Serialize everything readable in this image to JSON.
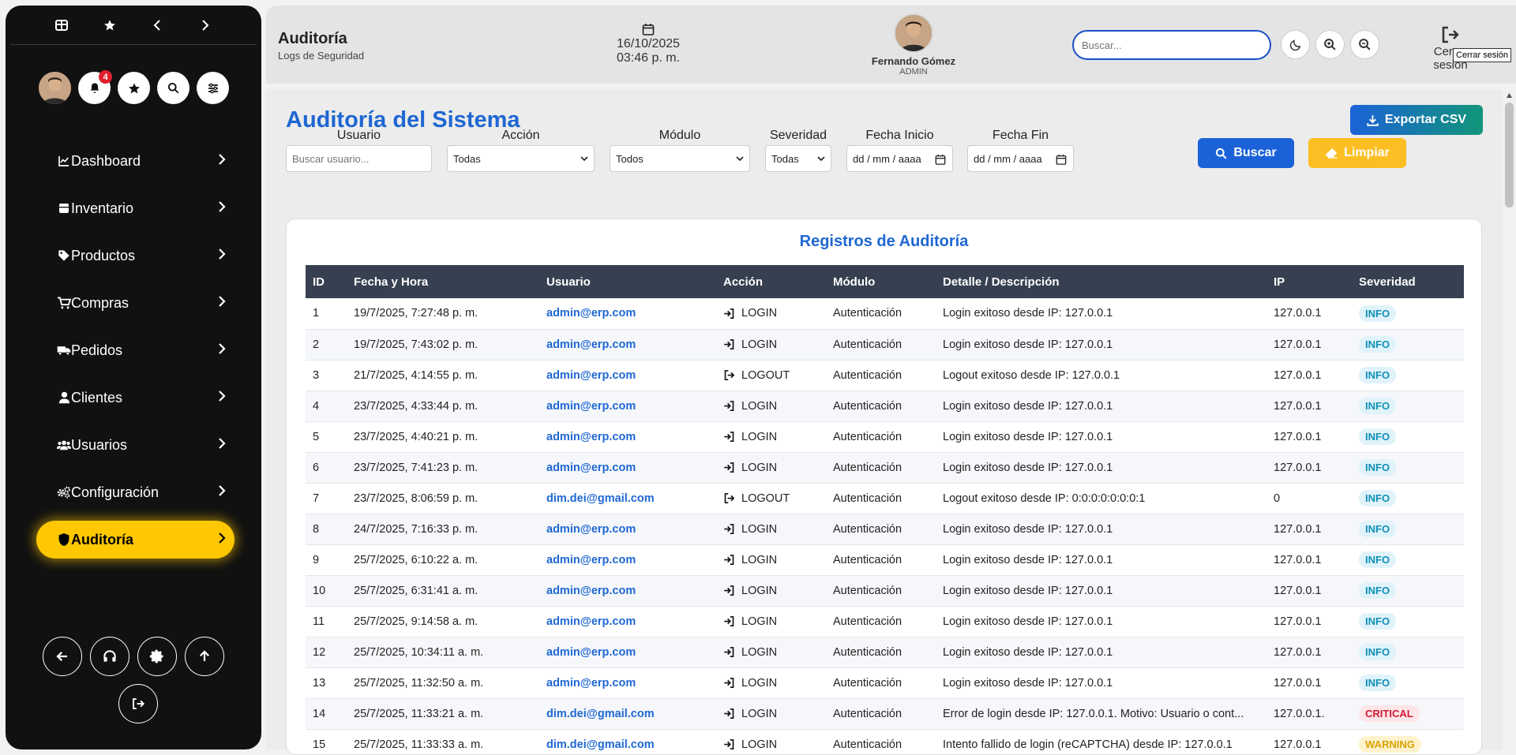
{
  "sidebar": {
    "notifications_count": "4",
    "nav": [
      {
        "label": "Dashboard",
        "icon": "chart-line-icon"
      },
      {
        "label": "Inventario",
        "icon": "box-icon"
      },
      {
        "label": "Productos",
        "icon": "tag-icon"
      },
      {
        "label": "Compras",
        "icon": "cart-icon"
      },
      {
        "label": "Pedidos",
        "icon": "truck-icon"
      },
      {
        "label": "Clientes",
        "icon": "user-icon"
      },
      {
        "label": "Usuarios",
        "icon": "users-icon"
      },
      {
        "label": "Configuración",
        "icon": "gears-icon"
      },
      {
        "label": "Auditoría",
        "icon": "shield-icon",
        "active": true
      }
    ]
  },
  "header": {
    "title": "Auditoría",
    "subtitle": "Logs de Seguridad",
    "date": "16/10/2025",
    "time": "03:46 p. m.",
    "user_name": "Fernando Gómez",
    "user_role": "ADMIN",
    "search_placeholder": "Buscar...",
    "logout_label": "Cerrar sesión",
    "logout_tooltip": "Cerrar sesión"
  },
  "main": {
    "title": "Auditoría del Sistema",
    "export_label": "Exportar CSV",
    "filters": {
      "usuario_label": "Usuario",
      "usuario_placeholder": "Buscar usuario...",
      "accion_label": "Acción",
      "accion_value": "Todas",
      "modulo_label": "Módulo",
      "modulo_value": "Todos",
      "severidad_label": "Severidad",
      "severidad_value": "Todas",
      "fecha_inicio_label": "Fecha Inicio",
      "fecha_inicio_value": "dd / mm / aaaa",
      "fecha_fin_label": "Fecha Fin",
      "fecha_fin_value": "dd / mm / aaaa",
      "buscar_label": "Buscar",
      "limpiar_label": "Limpiar"
    },
    "table_title": "Registros de Auditoría",
    "columns": [
      "ID",
      "Fecha y Hora",
      "Usuario",
      "Acción",
      "Módulo",
      "Detalle / Descripción",
      "IP",
      "Severidad"
    ],
    "rows": [
      {
        "id": "1",
        "fecha": "19/7/2025, 7:27:48 p. m.",
        "usuario": "admin@erp.com",
        "accion": "LOGIN",
        "modulo": "Autenticación",
        "detalle": "Login exitoso desde IP: 127.0.0.1",
        "ip": "127.0.0.1",
        "severidad": "INFO"
      },
      {
        "id": "2",
        "fecha": "19/7/2025, 7:43:02 p. m.",
        "usuario": "admin@erp.com",
        "accion": "LOGIN",
        "modulo": "Autenticación",
        "detalle": "Login exitoso desde IP: 127.0.0.1",
        "ip": "127.0.0.1",
        "severidad": "INFO"
      },
      {
        "id": "3",
        "fecha": "21/7/2025, 4:14:55 p. m.",
        "usuario": "admin@erp.com",
        "accion": "LOGOUT",
        "modulo": "Autenticación",
        "detalle": "Logout exitoso desde IP: 127.0.0.1",
        "ip": "127.0.0.1",
        "severidad": "INFO"
      },
      {
        "id": "4",
        "fecha": "23/7/2025, 4:33:44 p. m.",
        "usuario": "admin@erp.com",
        "accion": "LOGIN",
        "modulo": "Autenticación",
        "detalle": "Login exitoso desde IP: 127.0.0.1",
        "ip": "127.0.0.1",
        "severidad": "INFO"
      },
      {
        "id": "5",
        "fecha": "23/7/2025, 4:40:21 p. m.",
        "usuario": "admin@erp.com",
        "accion": "LOGIN",
        "modulo": "Autenticación",
        "detalle": "Login exitoso desde IP: 127.0.0.1",
        "ip": "127.0.0.1",
        "severidad": "INFO"
      },
      {
        "id": "6",
        "fecha": "23/7/2025, 7:41:23 p. m.",
        "usuario": "admin@erp.com",
        "accion": "LOGIN",
        "modulo": "Autenticación",
        "detalle": "Login exitoso desde IP: 127.0.0.1",
        "ip": "127.0.0.1",
        "severidad": "INFO"
      },
      {
        "id": "7",
        "fecha": "23/7/2025, 8:06:59 p. m.",
        "usuario": "dim.dei@gmail.com",
        "accion": "LOGOUT",
        "modulo": "Autenticación",
        "detalle": "Logout exitoso desde IP: 0:0:0:0:0:0:0:1",
        "ip": "0",
        "severidad": "INFO"
      },
      {
        "id": "8",
        "fecha": "24/7/2025, 7:16:33 p. m.",
        "usuario": "admin@erp.com",
        "accion": "LOGIN",
        "modulo": "Autenticación",
        "detalle": "Login exitoso desde IP: 127.0.0.1",
        "ip": "127.0.0.1",
        "severidad": "INFO"
      },
      {
        "id": "9",
        "fecha": "25/7/2025, 6:10:22 a. m.",
        "usuario": "admin@erp.com",
        "accion": "LOGIN",
        "modulo": "Autenticación",
        "detalle": "Login exitoso desde IP: 127.0.0.1",
        "ip": "127.0.0.1",
        "severidad": "INFO"
      },
      {
        "id": "10",
        "fecha": "25/7/2025, 6:31:41 a. m.",
        "usuario": "admin@erp.com",
        "accion": "LOGIN",
        "modulo": "Autenticación",
        "detalle": "Login exitoso desde IP: 127.0.0.1",
        "ip": "127.0.0.1",
        "severidad": "INFO"
      },
      {
        "id": "11",
        "fecha": "25/7/2025, 9:14:58 a. m.",
        "usuario": "admin@erp.com",
        "accion": "LOGIN",
        "modulo": "Autenticación",
        "detalle": "Login exitoso desde IP: 127.0.0.1",
        "ip": "127.0.0.1",
        "severidad": "INFO"
      },
      {
        "id": "12",
        "fecha": "25/7/2025, 10:34:11 a. m.",
        "usuario": "admin@erp.com",
        "accion": "LOGIN",
        "modulo": "Autenticación",
        "detalle": "Login exitoso desde IP: 127.0.0.1",
        "ip": "127.0.0.1",
        "severidad": "INFO"
      },
      {
        "id": "13",
        "fecha": "25/7/2025, 11:32:50 a. m.",
        "usuario": "admin@erp.com",
        "accion": "LOGIN",
        "modulo": "Autenticación",
        "detalle": "Login exitoso desde IP: 127.0.0.1",
        "ip": "127.0.0.1",
        "severidad": "INFO"
      },
      {
        "id": "14",
        "fecha": "25/7/2025, 11:33:21 a. m.",
        "usuario": "dim.dei@gmail.com",
        "accion": "LOGIN",
        "modulo": "Autenticación",
        "detalle": "Error de login desde IP: 127.0.0.1. Motivo: Usuario o cont...",
        "ip": "127.0.0.1.",
        "severidad": "CRITICAL"
      },
      {
        "id": "15",
        "fecha": "25/7/2025, 11:33:33 a. m.",
        "usuario": "dim.dei@gmail.com",
        "accion": "LOGIN",
        "modulo": "Autenticación",
        "detalle": "Intento fallido de login (reCAPTCHA) desde IP: 127.0.0.1",
        "ip": "127.0.0.1",
        "severidad": "WARNING"
      }
    ]
  },
  "colors": {
    "accent_blue": "#1f67d2",
    "active_nav": "#ffc800",
    "sidebar_bg": "#111111",
    "table_header": "#374050"
  }
}
